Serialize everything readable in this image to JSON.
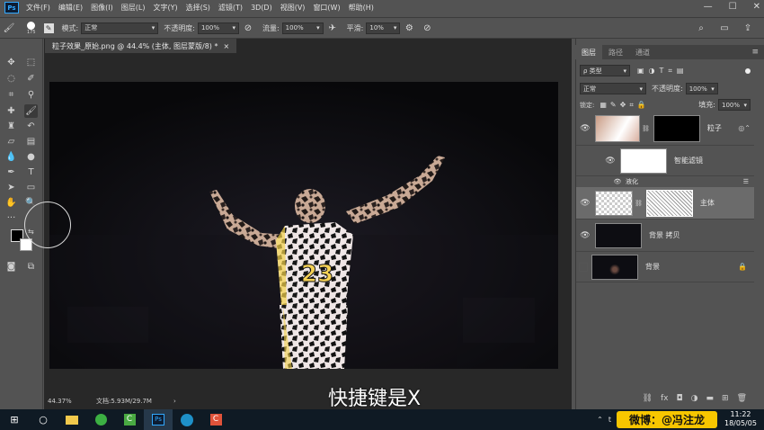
{
  "menubar": {
    "logo": "Ps",
    "items": [
      "文件(F)",
      "编辑(E)",
      "图像(I)",
      "图层(L)",
      "文字(Y)",
      "选择(S)",
      "滤镜(T)",
      "3D(D)",
      "视图(V)",
      "窗口(W)",
      "帮助(H)"
    ]
  },
  "options": {
    "brush_size": "175",
    "mode_label": "模式:",
    "mode_value": "正常",
    "opacity_label": "不透明度:",
    "opacity_value": "100%",
    "flow_label": "流量:",
    "flow_value": "100%",
    "smoothing_label": "平滑:",
    "smoothing_value": "10%"
  },
  "document": {
    "tab_title": "粒子效果_原始.png @ 44.4% (主体, 图层蒙版/8) *",
    "tab_close": "×",
    "zoom": "44.37%",
    "doc_info": "文档:5.93M/29.7M",
    "jersey_number": "23"
  },
  "subtitle": "快捷键是X",
  "panel": {
    "tabs": [
      "图层",
      "路径",
      "通道"
    ],
    "filter_kind": "ρ 类型",
    "blend_mode": "正常",
    "opacity_label": "不透明度:",
    "opacity_value": "100%",
    "lock_label": "锁定:",
    "fill_label": "填充:",
    "fill_value": "100%",
    "layers": [
      {
        "name": "粒子"
      },
      {
        "name": "智能滤镜"
      },
      {
        "name": "液化"
      },
      {
        "name": "主体"
      },
      {
        "name": "背景 拷贝"
      },
      {
        "name": "背景"
      }
    ],
    "bottom_icons": [
      "link-icon",
      "fx-icon",
      "mask-icon",
      "adjustment-icon",
      "folder-icon",
      "new-layer-icon",
      "trash-icon"
    ]
  },
  "taskbar": {
    "weibo": "微博：@冯注龙",
    "time": "11:22",
    "date": "18/05/05"
  },
  "colors": {
    "accent": "#31a8ff",
    "weibo_yellow": "#f7c600",
    "taskbar": "#0f1a24"
  }
}
